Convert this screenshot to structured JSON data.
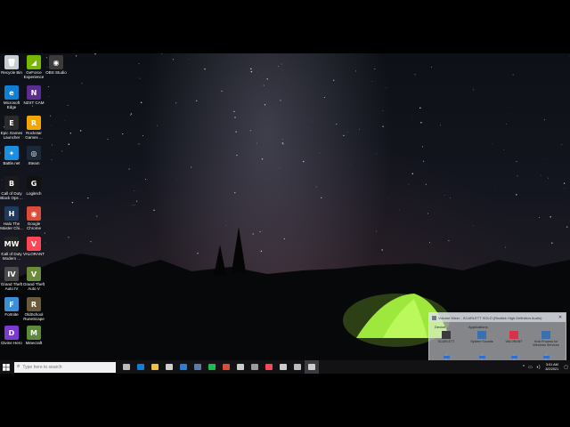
{
  "desktop": {
    "icons": [
      {
        "label": "Recycle Bin",
        "icon": "recycle-bin-icon",
        "color": "#c9ccd1",
        "glyph": "🗑"
      },
      {
        "label": "GeForce Experience",
        "icon": "geforce-experience-icon",
        "color": "#76b900",
        "glyph": "◢"
      },
      {
        "label": "OBS Studio",
        "icon": "obs-studio-icon",
        "color": "#3b3b3b",
        "glyph": "◉"
      },
      {
        "label": "Microsoft Edge",
        "icon": "edge-icon",
        "color": "#0f7fd6",
        "glyph": "e"
      },
      {
        "label": "NZXT CAM",
        "icon": "nzxt-cam-icon",
        "color": "#5b2d8e",
        "glyph": "N"
      },
      {
        "label": "Epic Games Launcher",
        "icon": "epic-games-icon",
        "color": "#2b2b2b",
        "glyph": "E"
      },
      {
        "label": "Rockstar Games ...",
        "icon": "rockstar-icon",
        "color": "#f3a500",
        "glyph": "R"
      },
      {
        "label": "Battle.net",
        "icon": "battlenet-icon",
        "color": "#1a8fe0",
        "glyph": "✦"
      },
      {
        "label": "Steam",
        "icon": "steam-icon",
        "color": "#1b2838",
        "glyph": "◎"
      },
      {
        "label": "Call of Duty Black Ops ...",
        "icon": "black-ops-icon",
        "color": "#1a1a1a",
        "glyph": "B"
      },
      {
        "label": "Logitech",
        "icon": "logitech-icon",
        "color": "#111111",
        "glyph": "G"
      },
      {
        "label": "Halo The Master Chi...",
        "icon": "halo-icon",
        "color": "#1f3a5c",
        "glyph": "H"
      },
      {
        "label": "Google Chrome",
        "icon": "chrome-icon",
        "color": "#dd4b39",
        "glyph": "◉"
      },
      {
        "label": "Call of Duty Modern ...",
        "icon": "modern-warfare-icon",
        "color": "#222222",
        "glyph": "MW"
      },
      {
        "label": "VALORANT",
        "icon": "valorant-icon",
        "color": "#ff4655",
        "glyph": "V"
      },
      {
        "label": "Grand Theft Auto IV",
        "icon": "gta-iv-icon",
        "color": "#4a4a4a",
        "glyph": "IV"
      },
      {
        "label": "Grand Theft Auto V",
        "icon": "gta-v-icon",
        "color": "#6a8c3a",
        "glyph": "V"
      },
      {
        "label": "Fortnite",
        "icon": "fortnite-icon",
        "color": "#3a8fd8",
        "glyph": "F"
      },
      {
        "label": "OldSchool RuneScape",
        "icon": "runescape-icon",
        "color": "#6b5a3a",
        "glyph": "R"
      },
      {
        "label": "Divine Hero",
        "icon": "divine-hero-icon",
        "color": "#7a3ad0",
        "glyph": "D"
      },
      {
        "label": "Minecraft",
        "icon": "minecraft-icon",
        "color": "#5d8a3a",
        "glyph": "M"
      }
    ]
  },
  "mixer": {
    "title": "Volume Mixer - SCARLETT SOLO (Realtek High Definition Audio)",
    "device_label": "Device",
    "applications_label": "Applications",
    "columns": [
      {
        "name": "SCARLETT",
        "icon": "speaker-device-icon",
        "color": "#3a3a3a",
        "level": 0.9
      },
      {
        "name": "System Sounds",
        "icon": "system-sounds-icon",
        "color": "#3a6fb0",
        "level": 0.9
      },
      {
        "name": "VALORANT",
        "icon": "valorant-app-icon",
        "color": "#d8324a",
        "level": 0.9
      },
      {
        "name": "Host Process for Windows Services",
        "icon": "host-process-icon",
        "color": "#3a6fb0",
        "level": 0.9
      }
    ]
  },
  "taskbar": {
    "search_placeholder": "Type here to search",
    "apps": [
      {
        "name": "task-view",
        "color": "#bbbbbb"
      },
      {
        "name": "edge",
        "color": "#0f7fd6"
      },
      {
        "name": "file-explorer",
        "color": "#f0c040"
      },
      {
        "name": "store",
        "color": "#cfcfcf"
      },
      {
        "name": "mail",
        "color": "#2a7fd4"
      },
      {
        "name": "steam",
        "color": "#5a7ca8"
      },
      {
        "name": "spotify",
        "color": "#1db954"
      },
      {
        "name": "chrome",
        "color": "#dd4b39"
      },
      {
        "name": "discord",
        "color": "#cccccc"
      },
      {
        "name": "nzxt",
        "color": "#9a9a9a"
      },
      {
        "name": "valorant",
        "color": "#ff4655"
      },
      {
        "name": "obs",
        "color": "#cccccc"
      },
      {
        "name": "settings",
        "color": "#bbbbbb"
      },
      {
        "name": "volume-mixer",
        "color": "#cccccc"
      }
    ],
    "time": "3:01 AM",
    "date": "8/2/2021"
  }
}
